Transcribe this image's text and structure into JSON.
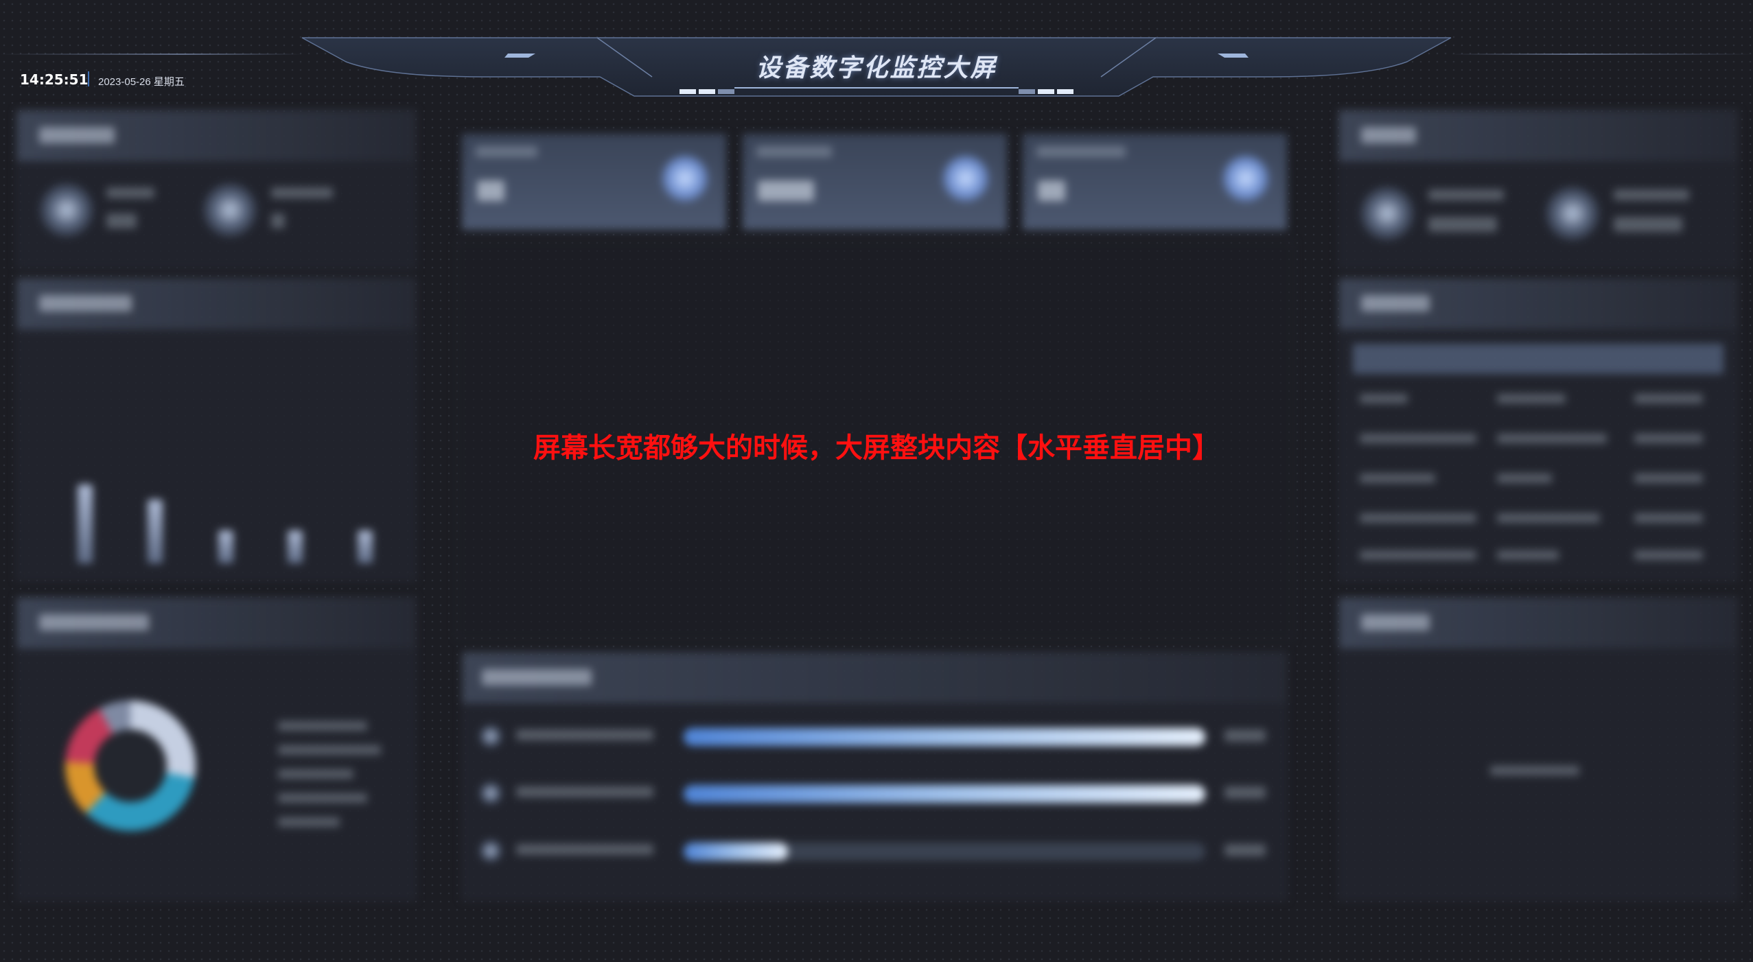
{
  "header": {
    "title": "设备数字化监控大屏",
    "time": "14:25:51",
    "date": "2023-05-26 星期五"
  },
  "notice": "屏幕长宽都够大的时候，大屏整块内容【水平垂直居中】",
  "colors": {
    "background": "#1c1d23",
    "notice_text": "#ff1010",
    "accent": "#3e6fb5"
  }
}
